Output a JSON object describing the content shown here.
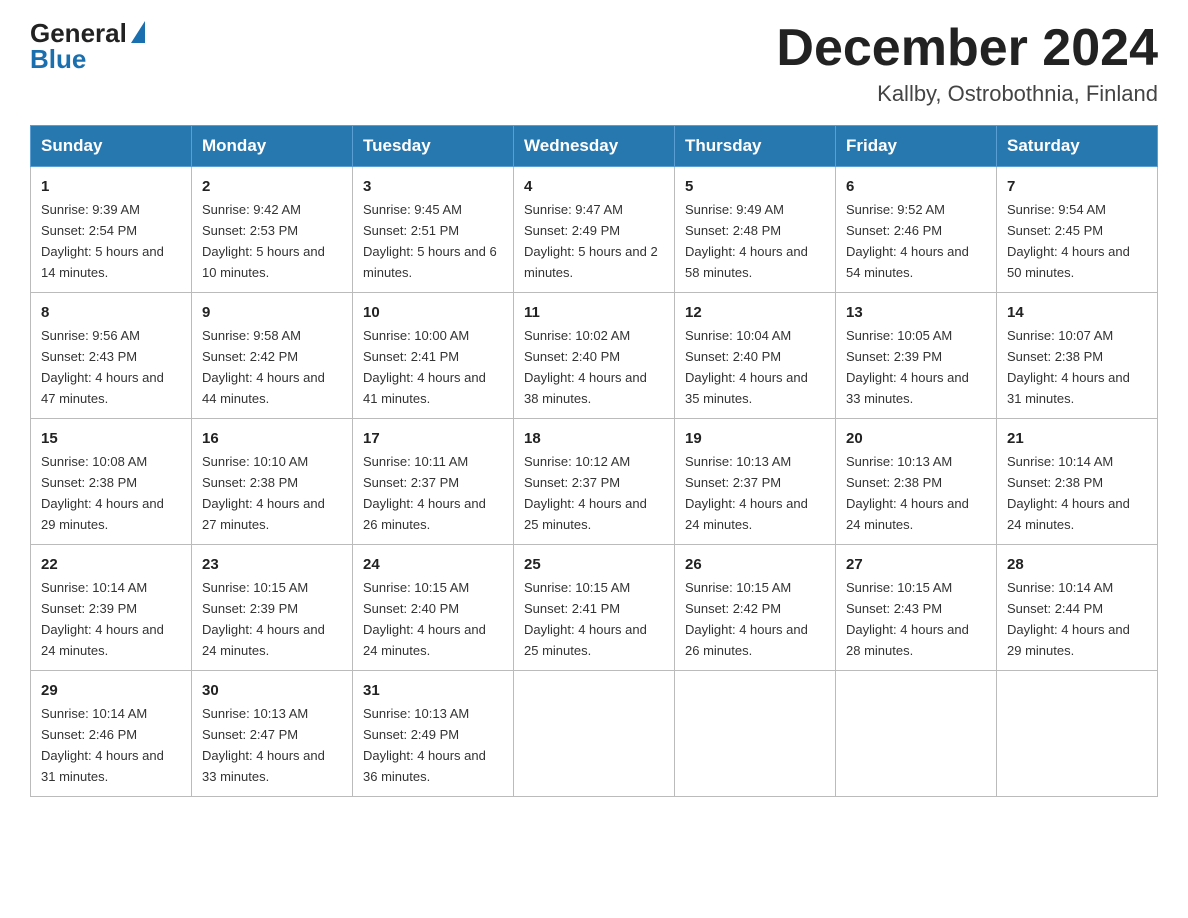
{
  "header": {
    "logo_general": "General",
    "logo_blue": "Blue",
    "month_title": "December 2024",
    "location": "Kallby, Ostrobothnia, Finland"
  },
  "weekdays": [
    "Sunday",
    "Monday",
    "Tuesday",
    "Wednesday",
    "Thursday",
    "Friday",
    "Saturday"
  ],
  "weeks": [
    [
      {
        "day": "1",
        "sunrise": "9:39 AM",
        "sunset": "2:54 PM",
        "daylight": "5 hours and 14 minutes."
      },
      {
        "day": "2",
        "sunrise": "9:42 AM",
        "sunset": "2:53 PM",
        "daylight": "5 hours and 10 minutes."
      },
      {
        "day": "3",
        "sunrise": "9:45 AM",
        "sunset": "2:51 PM",
        "daylight": "5 hours and 6 minutes."
      },
      {
        "day": "4",
        "sunrise": "9:47 AM",
        "sunset": "2:49 PM",
        "daylight": "5 hours and 2 minutes."
      },
      {
        "day": "5",
        "sunrise": "9:49 AM",
        "sunset": "2:48 PM",
        "daylight": "4 hours and 58 minutes."
      },
      {
        "day": "6",
        "sunrise": "9:52 AM",
        "sunset": "2:46 PM",
        "daylight": "4 hours and 54 minutes."
      },
      {
        "day": "7",
        "sunrise": "9:54 AM",
        "sunset": "2:45 PM",
        "daylight": "4 hours and 50 minutes."
      }
    ],
    [
      {
        "day": "8",
        "sunrise": "9:56 AM",
        "sunset": "2:43 PM",
        "daylight": "4 hours and 47 minutes."
      },
      {
        "day": "9",
        "sunrise": "9:58 AM",
        "sunset": "2:42 PM",
        "daylight": "4 hours and 44 minutes."
      },
      {
        "day": "10",
        "sunrise": "10:00 AM",
        "sunset": "2:41 PM",
        "daylight": "4 hours and 41 minutes."
      },
      {
        "day": "11",
        "sunrise": "10:02 AM",
        "sunset": "2:40 PM",
        "daylight": "4 hours and 38 minutes."
      },
      {
        "day": "12",
        "sunrise": "10:04 AM",
        "sunset": "2:40 PM",
        "daylight": "4 hours and 35 minutes."
      },
      {
        "day": "13",
        "sunrise": "10:05 AM",
        "sunset": "2:39 PM",
        "daylight": "4 hours and 33 minutes."
      },
      {
        "day": "14",
        "sunrise": "10:07 AM",
        "sunset": "2:38 PM",
        "daylight": "4 hours and 31 minutes."
      }
    ],
    [
      {
        "day": "15",
        "sunrise": "10:08 AM",
        "sunset": "2:38 PM",
        "daylight": "4 hours and 29 minutes."
      },
      {
        "day": "16",
        "sunrise": "10:10 AM",
        "sunset": "2:38 PM",
        "daylight": "4 hours and 27 minutes."
      },
      {
        "day": "17",
        "sunrise": "10:11 AM",
        "sunset": "2:37 PM",
        "daylight": "4 hours and 26 minutes."
      },
      {
        "day": "18",
        "sunrise": "10:12 AM",
        "sunset": "2:37 PM",
        "daylight": "4 hours and 25 minutes."
      },
      {
        "day": "19",
        "sunrise": "10:13 AM",
        "sunset": "2:37 PM",
        "daylight": "4 hours and 24 minutes."
      },
      {
        "day": "20",
        "sunrise": "10:13 AM",
        "sunset": "2:38 PM",
        "daylight": "4 hours and 24 minutes."
      },
      {
        "day": "21",
        "sunrise": "10:14 AM",
        "sunset": "2:38 PM",
        "daylight": "4 hours and 24 minutes."
      }
    ],
    [
      {
        "day": "22",
        "sunrise": "10:14 AM",
        "sunset": "2:39 PM",
        "daylight": "4 hours and 24 minutes."
      },
      {
        "day": "23",
        "sunrise": "10:15 AM",
        "sunset": "2:39 PM",
        "daylight": "4 hours and 24 minutes."
      },
      {
        "day": "24",
        "sunrise": "10:15 AM",
        "sunset": "2:40 PM",
        "daylight": "4 hours and 24 minutes."
      },
      {
        "day": "25",
        "sunrise": "10:15 AM",
        "sunset": "2:41 PM",
        "daylight": "4 hours and 25 minutes."
      },
      {
        "day": "26",
        "sunrise": "10:15 AM",
        "sunset": "2:42 PM",
        "daylight": "4 hours and 26 minutes."
      },
      {
        "day": "27",
        "sunrise": "10:15 AM",
        "sunset": "2:43 PM",
        "daylight": "4 hours and 28 minutes."
      },
      {
        "day": "28",
        "sunrise": "10:14 AM",
        "sunset": "2:44 PM",
        "daylight": "4 hours and 29 minutes."
      }
    ],
    [
      {
        "day": "29",
        "sunrise": "10:14 AM",
        "sunset": "2:46 PM",
        "daylight": "4 hours and 31 minutes."
      },
      {
        "day": "30",
        "sunrise": "10:13 AM",
        "sunset": "2:47 PM",
        "daylight": "4 hours and 33 minutes."
      },
      {
        "day": "31",
        "sunrise": "10:13 AM",
        "sunset": "2:49 PM",
        "daylight": "4 hours and 36 minutes."
      },
      null,
      null,
      null,
      null
    ]
  ]
}
